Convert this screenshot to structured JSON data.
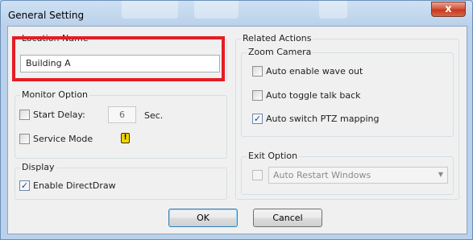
{
  "window": {
    "title": "General Setting",
    "close_label": "x"
  },
  "location": {
    "label": "Location Name",
    "value": "Building A"
  },
  "monitor_option": {
    "label": "Monitor Option",
    "start_delay_label": "Start Delay:",
    "start_delay_value": "6",
    "start_delay_unit": "Sec.",
    "service_mode_label": "Service Mode",
    "warning_glyph": "!"
  },
  "display": {
    "label": "Display",
    "enable_directdraw_label": "Enable DirectDraw"
  },
  "related_actions": {
    "label": "Related Actions",
    "zoom_camera": {
      "label": "Zoom Camera",
      "auto_wave_out_label": "Auto enable wave out",
      "auto_talk_back_label": "Auto toggle talk back",
      "auto_ptz_label": "Auto switch PTZ mapping"
    },
    "exit_option": {
      "label": "Exit Option",
      "selected": "Auto Restart Windows"
    }
  },
  "buttons": {
    "ok": "OK",
    "cancel": "Cancel"
  },
  "icons": {
    "close": "close-icon",
    "check": "✓",
    "dropdown": "▼"
  },
  "colors": {
    "highlight": "#e61c24"
  }
}
